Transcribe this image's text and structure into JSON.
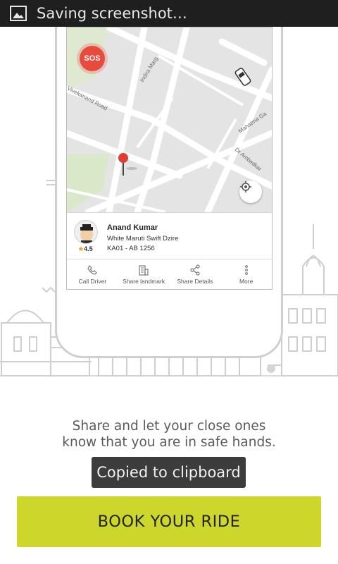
{
  "status_bar": {
    "icon": "image-icon",
    "text": "Saving screenshot…"
  },
  "map": {
    "sos_label": "SOS",
    "street_labels": [
      "Indira Marg",
      "Vivekanand Road",
      "Mahatma Ga",
      "Dr Ambedkar"
    ],
    "pin_icon": "location-pin-icon",
    "car_icon": "car-icon",
    "locate_icon": "my-location-icon"
  },
  "driver": {
    "name": "Anand Kumar",
    "car_model": "White Maruti Swift Dzire",
    "plate": "KA01 - AB 1256",
    "rating": "4.5"
  },
  "actions": [
    {
      "label": "Call Driver",
      "icon": "phone-icon"
    },
    {
      "label": "Share landmark",
      "icon": "building-icon"
    },
    {
      "label": "Share Details",
      "icon": "share-icon"
    },
    {
      "label": "More",
      "icon": "more-vertical-icon"
    }
  ],
  "tagline": {
    "line1": "Share and let your close ones",
    "line2": "know that you are in safe hands."
  },
  "toast": "Copied to clipboard",
  "cta": "BOOK YOUR RIDE",
  "colors": {
    "accent": "#cdd62a",
    "sos": "#e84a3e",
    "toast_bg": "#3c3c3c",
    "status_bar": "#1f1f1f"
  }
}
